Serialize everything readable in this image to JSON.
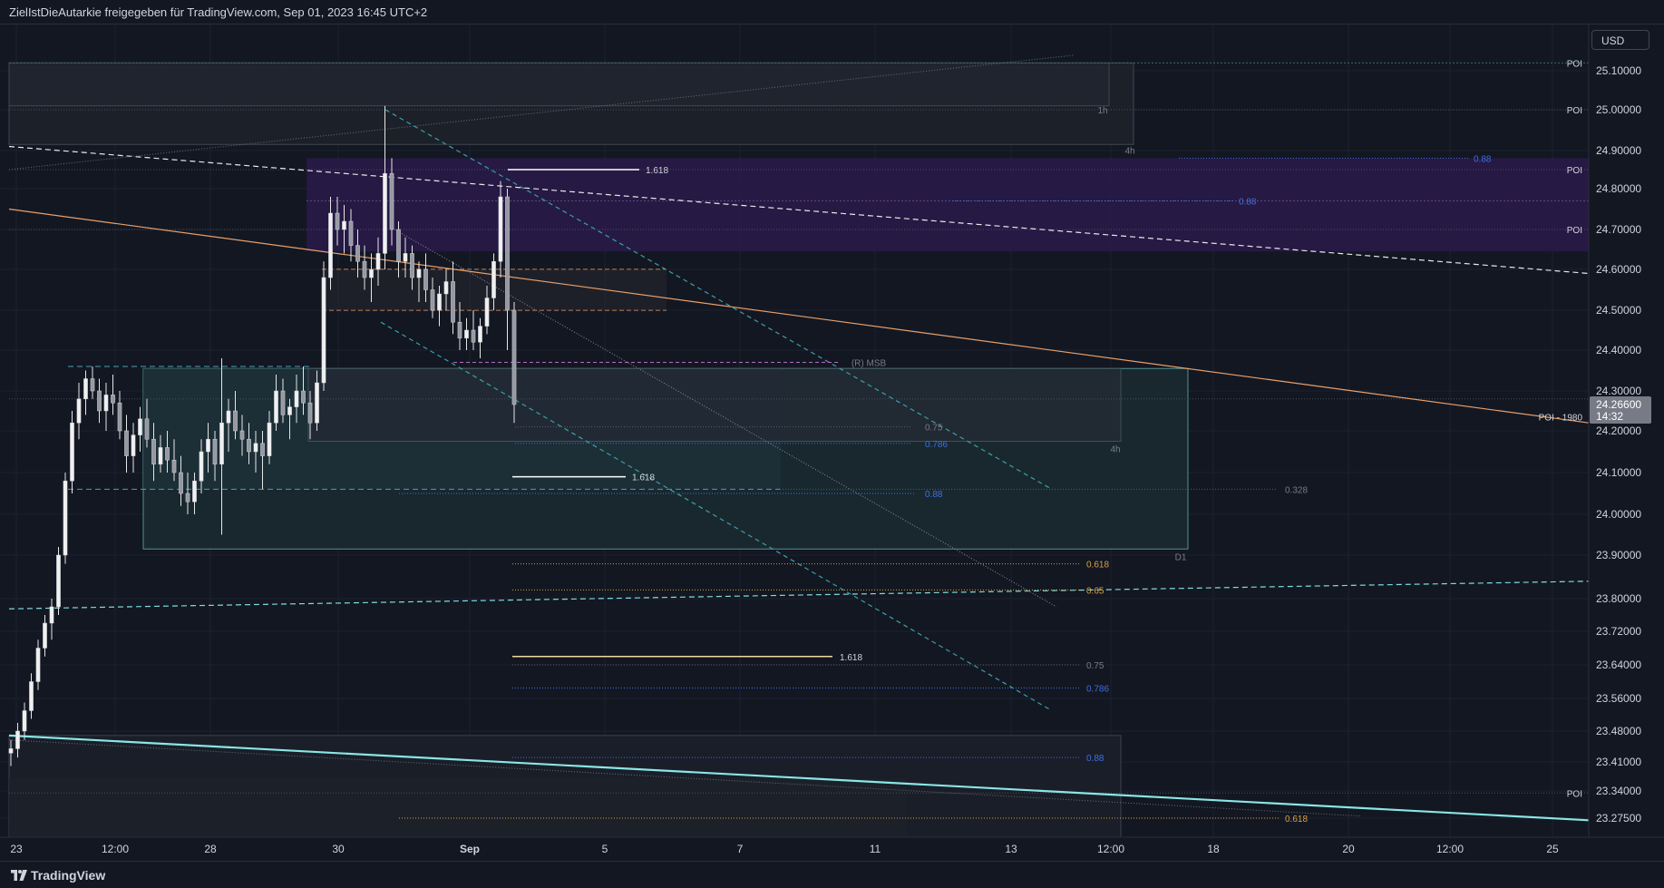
{
  "header": {
    "attribution": "ZielIstDieAutarkie freigegeben für TradingView.com, Sep 01, 2023 16:45 UTC+2"
  },
  "footer": {
    "brand": "TradingView",
    "logo_icon": "tradingview-logo-icon"
  },
  "currency_button": "USD",
  "colors": {
    "background": "#131722",
    "grid": "#1e222d",
    "axis_text": "#d1d4dc",
    "candle": "#e6e6e6",
    "purple_zone": "#2a1a4a",
    "teal_line": "#7fdcdc",
    "orange_line": "#e8a06a",
    "fib_orange": "#d8a040",
    "fib_blue": "#3d6fe0",
    "price_label_bg": "#787b86"
  },
  "chart_data": {
    "type": "candlestick",
    "y_axis": {
      "ticks": [
        "25.10000",
        "25.00000",
        "24.90000",
        "24.80000",
        "24.70000",
        "24.60000",
        "24.50000",
        "24.40000",
        "24.30000",
        "24.20000",
        "24.10000",
        "24.00000",
        "23.90000",
        "23.80000",
        "23.72000",
        "23.64000",
        "23.56000",
        "23.48000",
        "23.41000",
        "23.34000",
        "23.27500"
      ]
    },
    "x_axis": {
      "ticks": [
        "23",
        "12:00",
        "28",
        "30",
        "Sep",
        "5",
        "7",
        "11",
        "13",
        "12:00",
        "18",
        "20",
        "12:00",
        "25"
      ]
    },
    "last_price": {
      "value": "24.26600",
      "countdown": "14:32",
      "label": "POI - 1980"
    },
    "right_labels": [
      "POI",
      "POI",
      "POI",
      "POI",
      "POI"
    ],
    "zone_labels": [
      "1h",
      "4h",
      "4h",
      "D1",
      "(R) MSB"
    ],
    "fib_labels": [
      {
        "text": "1.618",
        "color": "white"
      },
      {
        "text": "1.618",
        "color": "white"
      },
      {
        "text": "1.618",
        "color": "white"
      },
      {
        "text": "0.75",
        "color": "gray"
      },
      {
        "text": "0.786",
        "color": "blue"
      },
      {
        "text": "0.88",
        "color": "blue"
      },
      {
        "text": "0.328",
        "color": "gray"
      },
      {
        "text": "0.618",
        "color": "orange"
      },
      {
        "text": "0.65",
        "color": "orange"
      },
      {
        "text": "0.75",
        "color": "gray"
      },
      {
        "text": "0.786",
        "color": "blue"
      },
      {
        "text": "0.88",
        "color": "blue"
      },
      {
        "text": "0.88",
        "color": "blue"
      },
      {
        "text": "0.88",
        "color": "blue"
      },
      {
        "text": "0.618",
        "color": "orange"
      }
    ],
    "candles": [
      [
        23.43,
        23.46,
        23.4,
        23.44
      ],
      [
        23.44,
        23.5,
        23.42,
        23.48
      ],
      [
        23.48,
        23.55,
        23.46,
        23.53
      ],
      [
        23.53,
        23.62,
        23.51,
        23.6
      ],
      [
        23.6,
        23.7,
        23.58,
        23.68
      ],
      [
        23.68,
        23.76,
        23.66,
        23.74
      ],
      [
        23.74,
        23.8,
        23.7,
        23.78
      ],
      [
        23.78,
        23.92,
        23.76,
        23.9
      ],
      [
        23.9,
        24.1,
        23.88,
        24.08
      ],
      [
        24.08,
        24.25,
        24.05,
        24.22
      ],
      [
        24.22,
        24.32,
        24.18,
        24.28
      ],
      [
        24.28,
        24.35,
        24.24,
        24.33
      ],
      [
        24.33,
        24.36,
        24.28,
        24.3
      ],
      [
        24.3,
        24.33,
        24.22,
        24.25
      ],
      [
        24.25,
        24.32,
        24.2,
        24.29
      ],
      [
        24.29,
        24.34,
        24.24,
        24.27
      ],
      [
        24.27,
        24.3,
        24.18,
        24.2
      ],
      [
        24.2,
        24.24,
        24.1,
        24.14
      ],
      [
        24.14,
        24.22,
        24.1,
        24.19
      ],
      [
        24.19,
        24.26,
        24.15,
        24.23
      ],
      [
        24.23,
        24.28,
        24.16,
        24.18
      ],
      [
        24.18,
        24.22,
        24.08,
        24.12
      ],
      [
        24.12,
        24.19,
        24.1,
        24.16
      ],
      [
        24.16,
        24.2,
        24.1,
        24.13
      ],
      [
        24.13,
        24.18,
        24.08,
        24.1
      ],
      [
        24.1,
        24.14,
        24.02,
        24.05
      ],
      [
        24.05,
        24.1,
        24.0,
        24.03
      ],
      [
        24.03,
        24.1,
        24.0,
        24.08
      ],
      [
        24.08,
        24.18,
        24.05,
        24.15
      ],
      [
        24.15,
        24.22,
        24.1,
        24.18
      ],
      [
        24.18,
        24.2,
        24.08,
        24.12
      ],
      [
        24.12,
        24.38,
        23.95,
        24.22
      ],
      [
        24.22,
        24.28,
        24.15,
        24.25
      ],
      [
        24.25,
        24.3,
        24.18,
        24.2
      ],
      [
        24.2,
        24.24,
        24.14,
        24.18
      ],
      [
        24.18,
        24.22,
        24.12,
        24.15
      ],
      [
        24.15,
        24.2,
        24.1,
        24.17
      ],
      [
        24.17,
        24.2,
        24.06,
        24.14
      ],
      [
        24.14,
        24.25,
        24.12,
        24.22
      ],
      [
        24.22,
        24.34,
        24.2,
        24.3
      ],
      [
        24.3,
        24.33,
        24.22,
        24.24
      ],
      [
        24.24,
        24.28,
        24.18,
        24.26
      ],
      [
        24.26,
        24.34,
        24.22,
        24.3
      ],
      [
        24.3,
        24.36,
        24.24,
        24.27
      ],
      [
        24.27,
        24.3,
        24.18,
        24.22
      ],
      [
        24.22,
        24.35,
        24.2,
        24.32
      ],
      [
        24.32,
        24.62,
        24.3,
        24.58
      ],
      [
        24.58,
        24.78,
        24.55,
        24.74
      ],
      [
        24.74,
        24.78,
        24.66,
        24.7
      ],
      [
        24.7,
        24.76,
        24.64,
        24.72
      ],
      [
        24.72,
        24.75,
        24.62,
        24.66
      ],
      [
        24.66,
        24.7,
        24.58,
        24.62
      ],
      [
        24.62,
        24.66,
        24.55,
        24.58
      ],
      [
        24.58,
        24.64,
        24.52,
        24.6
      ],
      [
        24.6,
        24.68,
        24.56,
        24.64
      ],
      [
        24.64,
        25.01,
        24.6,
        24.84
      ],
      [
        24.84,
        24.88,
        24.66,
        24.7
      ],
      [
        24.7,
        24.72,
        24.58,
        24.62
      ],
      [
        24.62,
        24.68,
        24.58,
        24.64
      ],
      [
        24.64,
        24.66,
        24.55,
        24.58
      ],
      [
        24.58,
        24.62,
        24.52,
        24.6
      ],
      [
        24.6,
        24.64,
        24.52,
        24.55
      ],
      [
        24.55,
        24.58,
        24.48,
        24.5
      ],
      [
        24.5,
        24.56,
        24.46,
        24.54
      ],
      [
        24.54,
        24.6,
        24.5,
        24.57
      ],
      [
        24.57,
        24.62,
        24.44,
        24.47
      ],
      [
        24.47,
        24.52,
        24.4,
        24.43
      ],
      [
        24.43,
        24.48,
        24.4,
        24.45
      ],
      [
        24.45,
        24.5,
        24.4,
        24.42
      ],
      [
        24.42,
        24.48,
        24.38,
        24.46
      ],
      [
        24.46,
        24.56,
        24.44,
        24.53
      ],
      [
        24.53,
        24.64,
        24.5,
        24.62
      ],
      [
        24.62,
        24.82,
        24.58,
        24.78
      ],
      [
        24.78,
        24.8,
        24.4,
        24.5
      ],
      [
        24.5,
        24.52,
        24.22,
        24.266
      ]
    ]
  }
}
